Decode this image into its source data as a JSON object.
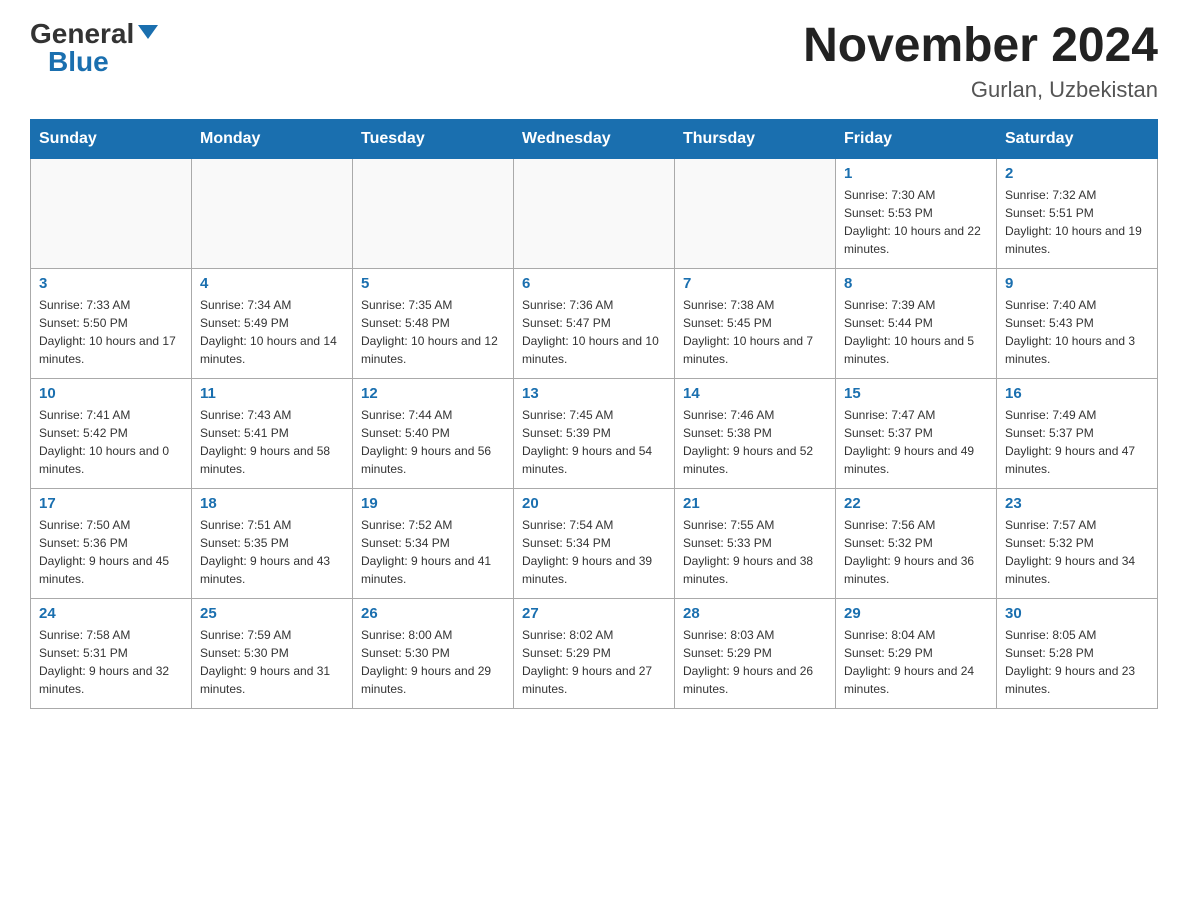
{
  "header": {
    "logo_general": "General",
    "logo_blue": "Blue",
    "month_title": "November 2024",
    "location": "Gurlan, Uzbekistan"
  },
  "days_of_week": [
    "Sunday",
    "Monday",
    "Tuesday",
    "Wednesday",
    "Thursday",
    "Friday",
    "Saturday"
  ],
  "weeks": [
    [
      {
        "day": "",
        "info": ""
      },
      {
        "day": "",
        "info": ""
      },
      {
        "day": "",
        "info": ""
      },
      {
        "day": "",
        "info": ""
      },
      {
        "day": "",
        "info": ""
      },
      {
        "day": "1",
        "info": "Sunrise: 7:30 AM\nSunset: 5:53 PM\nDaylight: 10 hours and 22 minutes."
      },
      {
        "day": "2",
        "info": "Sunrise: 7:32 AM\nSunset: 5:51 PM\nDaylight: 10 hours and 19 minutes."
      }
    ],
    [
      {
        "day": "3",
        "info": "Sunrise: 7:33 AM\nSunset: 5:50 PM\nDaylight: 10 hours and 17 minutes."
      },
      {
        "day": "4",
        "info": "Sunrise: 7:34 AM\nSunset: 5:49 PM\nDaylight: 10 hours and 14 minutes."
      },
      {
        "day": "5",
        "info": "Sunrise: 7:35 AM\nSunset: 5:48 PM\nDaylight: 10 hours and 12 minutes."
      },
      {
        "day": "6",
        "info": "Sunrise: 7:36 AM\nSunset: 5:47 PM\nDaylight: 10 hours and 10 minutes."
      },
      {
        "day": "7",
        "info": "Sunrise: 7:38 AM\nSunset: 5:45 PM\nDaylight: 10 hours and 7 minutes."
      },
      {
        "day": "8",
        "info": "Sunrise: 7:39 AM\nSunset: 5:44 PM\nDaylight: 10 hours and 5 minutes."
      },
      {
        "day": "9",
        "info": "Sunrise: 7:40 AM\nSunset: 5:43 PM\nDaylight: 10 hours and 3 minutes."
      }
    ],
    [
      {
        "day": "10",
        "info": "Sunrise: 7:41 AM\nSunset: 5:42 PM\nDaylight: 10 hours and 0 minutes."
      },
      {
        "day": "11",
        "info": "Sunrise: 7:43 AM\nSunset: 5:41 PM\nDaylight: 9 hours and 58 minutes."
      },
      {
        "day": "12",
        "info": "Sunrise: 7:44 AM\nSunset: 5:40 PM\nDaylight: 9 hours and 56 minutes."
      },
      {
        "day": "13",
        "info": "Sunrise: 7:45 AM\nSunset: 5:39 PM\nDaylight: 9 hours and 54 minutes."
      },
      {
        "day": "14",
        "info": "Sunrise: 7:46 AM\nSunset: 5:38 PM\nDaylight: 9 hours and 52 minutes."
      },
      {
        "day": "15",
        "info": "Sunrise: 7:47 AM\nSunset: 5:37 PM\nDaylight: 9 hours and 49 minutes."
      },
      {
        "day": "16",
        "info": "Sunrise: 7:49 AM\nSunset: 5:37 PM\nDaylight: 9 hours and 47 minutes."
      }
    ],
    [
      {
        "day": "17",
        "info": "Sunrise: 7:50 AM\nSunset: 5:36 PM\nDaylight: 9 hours and 45 minutes."
      },
      {
        "day": "18",
        "info": "Sunrise: 7:51 AM\nSunset: 5:35 PM\nDaylight: 9 hours and 43 minutes."
      },
      {
        "day": "19",
        "info": "Sunrise: 7:52 AM\nSunset: 5:34 PM\nDaylight: 9 hours and 41 minutes."
      },
      {
        "day": "20",
        "info": "Sunrise: 7:54 AM\nSunset: 5:34 PM\nDaylight: 9 hours and 39 minutes."
      },
      {
        "day": "21",
        "info": "Sunrise: 7:55 AM\nSunset: 5:33 PM\nDaylight: 9 hours and 38 minutes."
      },
      {
        "day": "22",
        "info": "Sunrise: 7:56 AM\nSunset: 5:32 PM\nDaylight: 9 hours and 36 minutes."
      },
      {
        "day": "23",
        "info": "Sunrise: 7:57 AM\nSunset: 5:32 PM\nDaylight: 9 hours and 34 minutes."
      }
    ],
    [
      {
        "day": "24",
        "info": "Sunrise: 7:58 AM\nSunset: 5:31 PM\nDaylight: 9 hours and 32 minutes."
      },
      {
        "day": "25",
        "info": "Sunrise: 7:59 AM\nSunset: 5:30 PM\nDaylight: 9 hours and 31 minutes."
      },
      {
        "day": "26",
        "info": "Sunrise: 8:00 AM\nSunset: 5:30 PM\nDaylight: 9 hours and 29 minutes."
      },
      {
        "day": "27",
        "info": "Sunrise: 8:02 AM\nSunset: 5:29 PM\nDaylight: 9 hours and 27 minutes."
      },
      {
        "day": "28",
        "info": "Sunrise: 8:03 AM\nSunset: 5:29 PM\nDaylight: 9 hours and 26 minutes."
      },
      {
        "day": "29",
        "info": "Sunrise: 8:04 AM\nSunset: 5:29 PM\nDaylight: 9 hours and 24 minutes."
      },
      {
        "day": "30",
        "info": "Sunrise: 8:05 AM\nSunset: 5:28 PM\nDaylight: 9 hours and 23 minutes."
      }
    ]
  ]
}
